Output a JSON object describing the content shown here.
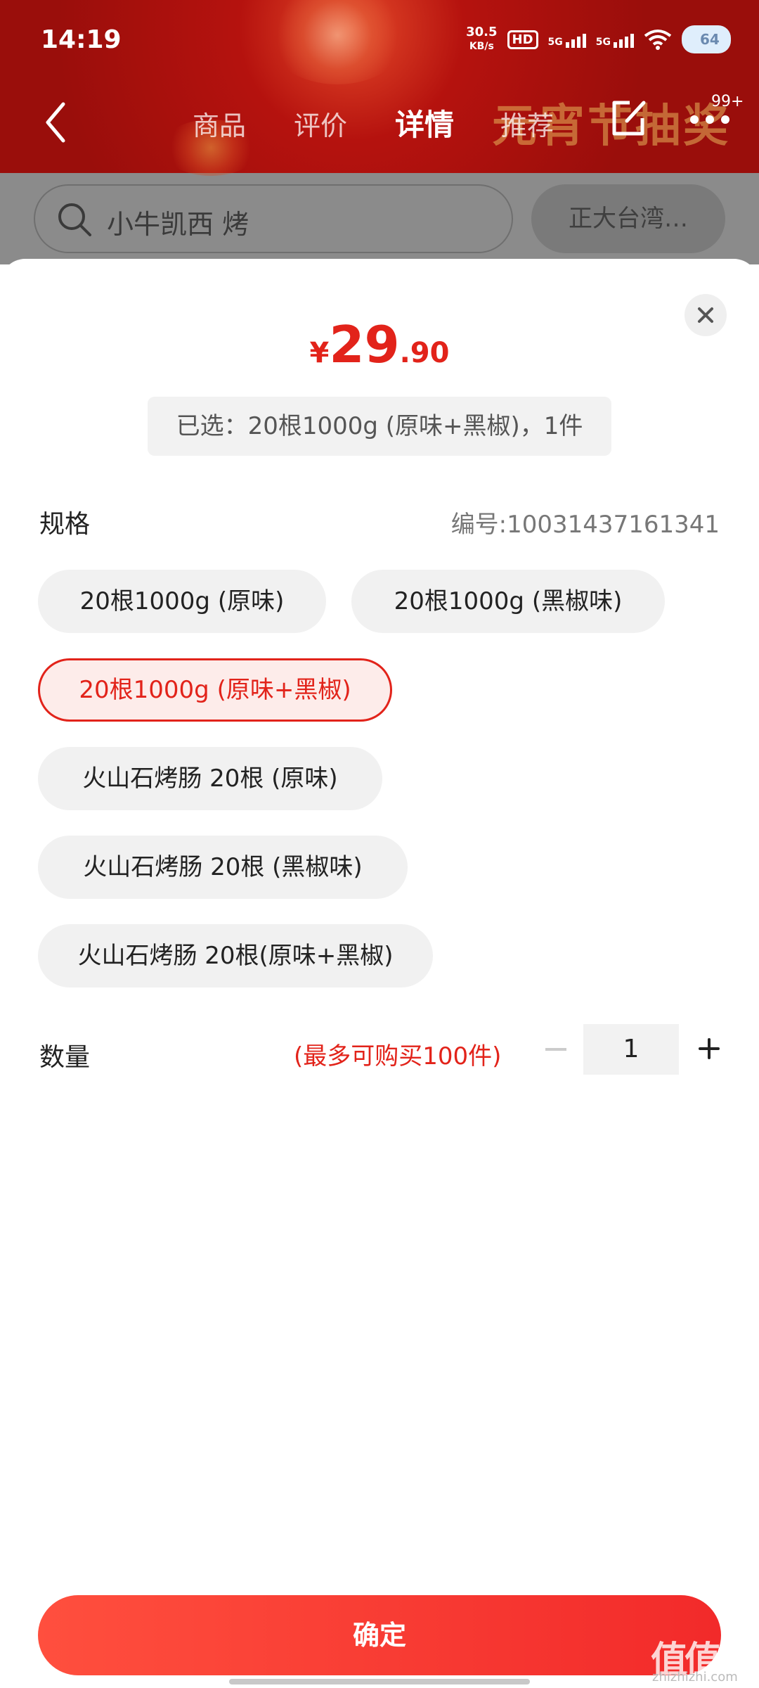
{
  "status_bar": {
    "time": "14:19",
    "net_speed": "30.5",
    "net_speed_unit": "KB/s",
    "hd": "HD",
    "signal_1": "5G",
    "signal_2": "5G",
    "battery": "64"
  },
  "nav": {
    "tabs": [
      "商品",
      "评价",
      "详情",
      "推荐"
    ],
    "active_tab": "详情",
    "banner_text": "元宵节抽奖",
    "badge": "99+"
  },
  "search": {
    "query": "小牛凯西 烤",
    "brand_chip": "正大台湾…"
  },
  "sheet": {
    "price_currency": "¥",
    "price_int": "29",
    "price_dec": ".90",
    "selected_summary": "已选：20根1000g (原味+黑椒)，1件",
    "spec_label": "规格",
    "sku_code": "编号:10031437161341",
    "options": [
      "20根1000g (原味)",
      "20根1000g (黑椒味)",
      "20根1000g (原味+黑椒)",
      "火山石烤肠 20根 (原味)",
      "火山石烤肠 20根 (黑椒味)",
      "火山石烤肠 20根(原味+黑椒)"
    ],
    "selected_option_index": 2,
    "quantity_label": "数量",
    "quantity_hint": "(最多可购买100件)",
    "quantity_value": "1",
    "confirm_label": "确定"
  },
  "watermark": {
    "logo": "值值值",
    "domain": "zhizhizhi.com"
  },
  "colors": {
    "accent": "#e2231a",
    "confirm_bg": "#f22a2a"
  }
}
